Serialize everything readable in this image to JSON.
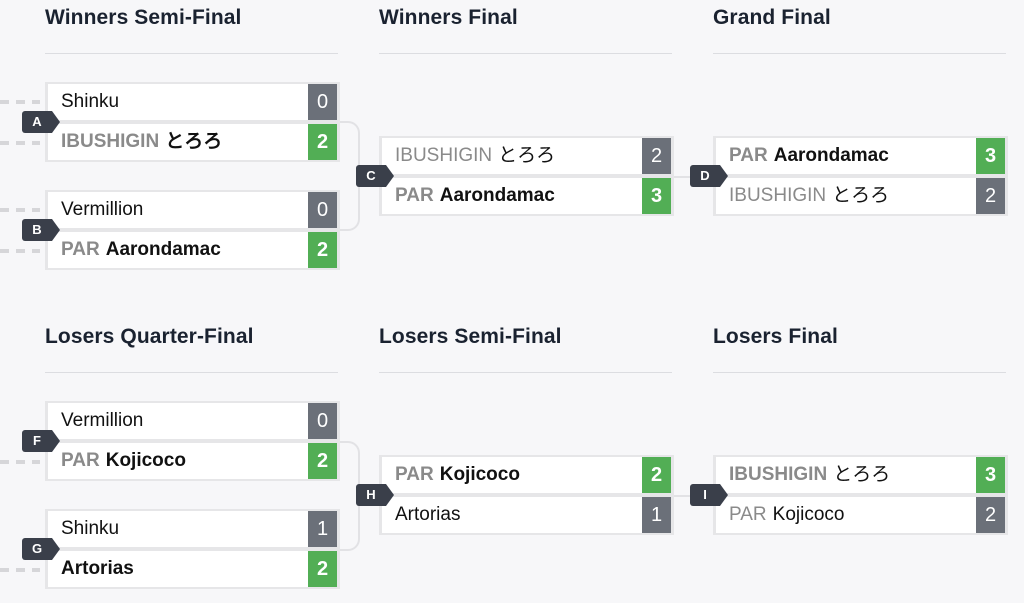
{
  "rounds": {
    "winners_semi": "Winners Semi-Final",
    "winners_final": "Winners Final",
    "grand_final": "Grand Final",
    "losers_quarter": "Losers Quarter-Final",
    "losers_semi": "Losers Semi-Final",
    "losers_final": "Losers Final"
  },
  "colors": {
    "win_score": "#52ae55",
    "loss_score": "#6b7079",
    "badge": "#3a3f4a"
  },
  "matches": {
    "A": {
      "id": "A",
      "top": {
        "prefix": "",
        "name": "Shinku",
        "score": "0",
        "winner": false
      },
      "bot": {
        "prefix": "IBUSHIGIN",
        "name": "とろろ",
        "score": "2",
        "winner": true
      }
    },
    "B": {
      "id": "B",
      "top": {
        "prefix": "",
        "name": "Vermillion",
        "score": "0",
        "winner": false
      },
      "bot": {
        "prefix": "PAR",
        "name": "Aarondamac",
        "score": "2",
        "winner": true
      }
    },
    "C": {
      "id": "C",
      "top": {
        "prefix": "IBUSHIGIN",
        "name": "とろろ",
        "score": "2",
        "winner": false
      },
      "bot": {
        "prefix": "PAR",
        "name": "Aarondamac",
        "score": "3",
        "winner": true
      }
    },
    "D": {
      "id": "D",
      "top": {
        "prefix": "PAR",
        "name": "Aarondamac",
        "score": "3",
        "winner": true
      },
      "bot": {
        "prefix": "IBUSHIGIN",
        "name": "とろろ",
        "score": "2",
        "winner": false
      }
    },
    "F": {
      "id": "F",
      "top": {
        "prefix": "",
        "name": "Vermillion",
        "score": "0",
        "winner": false
      },
      "bot": {
        "prefix": "PAR",
        "name": "Kojicoco",
        "score": "2",
        "winner": true
      }
    },
    "G": {
      "id": "G",
      "top": {
        "prefix": "",
        "name": "Shinku",
        "score": "1",
        "winner": false
      },
      "bot": {
        "prefix": "",
        "name": "Artorias",
        "score": "2",
        "winner": true
      }
    },
    "H": {
      "id": "H",
      "top": {
        "prefix": "PAR",
        "name": "Kojicoco",
        "score": "2",
        "winner": true
      },
      "bot": {
        "prefix": "",
        "name": "Artorias",
        "score": "1",
        "winner": false
      }
    },
    "I": {
      "id": "I",
      "top": {
        "prefix": "IBUSHIGIN",
        "name": "とろろ",
        "score": "3",
        "winner": true
      },
      "bot": {
        "prefix": "PAR",
        "name": "Kojicoco",
        "score": "2",
        "winner": false
      }
    }
  }
}
